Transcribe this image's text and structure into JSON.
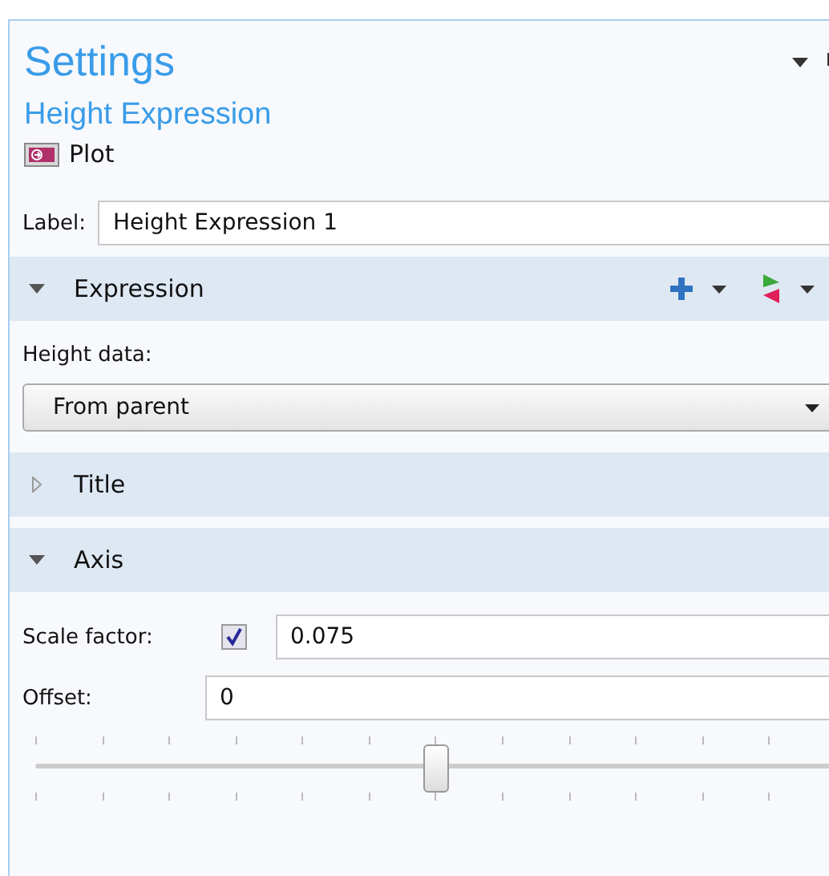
{
  "panel": {
    "title": "Settings",
    "subtitle": "Height Expression",
    "node": "Plot"
  },
  "label_field": {
    "label": "Label:",
    "value": "Height Expression 1"
  },
  "sections": [
    {
      "title": "Expression",
      "expanded": true,
      "tools": true,
      "rows": [
        {
          "kind": "select",
          "label": "Height data:",
          "value": "From parent"
        }
      ]
    },
    {
      "title": "Title",
      "expanded": false
    },
    {
      "title": "Axis",
      "expanded": true,
      "rows": [
        {
          "kind": "checkfield",
          "label": "Scale factor:",
          "checked": true,
          "value": "0.075"
        },
        {
          "kind": "field",
          "label": "Offset:",
          "value": "0"
        },
        {
          "kind": "slider",
          "level": 0.5
        }
      ]
    }
  ]
}
